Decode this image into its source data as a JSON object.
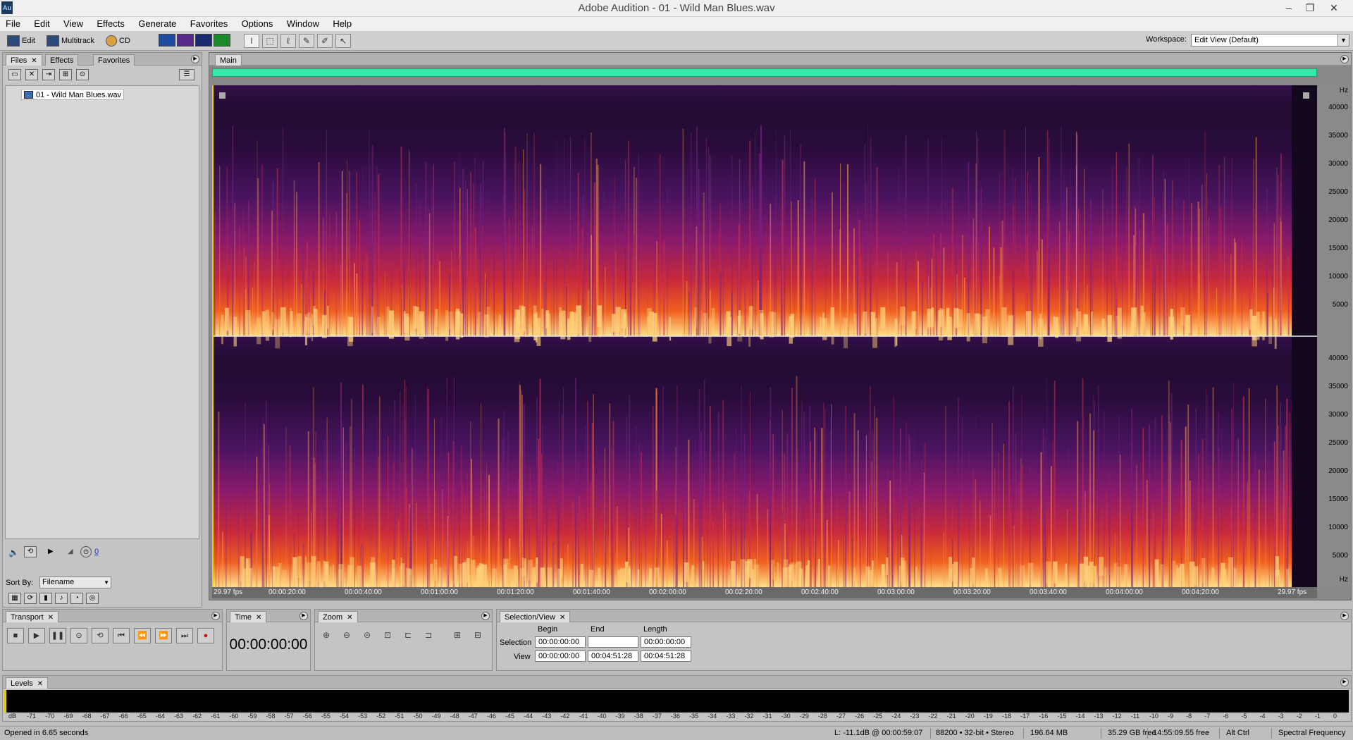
{
  "window": {
    "title": "Adobe Audition - 01 - Wild Man Blues.wav",
    "app_icon": "Au",
    "minimize": "–",
    "restore": "❐",
    "close": "✕"
  },
  "menu": [
    "File",
    "Edit",
    "View",
    "Effects",
    "Generate",
    "Favorites",
    "Options",
    "Window",
    "Help"
  ],
  "toolbar": {
    "edit_label": "Edit",
    "multitrack_label": "Multitrack",
    "cd_label": "CD",
    "workspace_label": "Workspace:",
    "workspace_value": "Edit View (Default)"
  },
  "files_panel": {
    "tabs": [
      "Files",
      "Effects",
      "Favorites"
    ],
    "file_name": "01 - Wild Man Blues.wav",
    "sort_label": "Sort By:",
    "sort_value": "Filename",
    "preview_counter": "0"
  },
  "main_panel": {
    "tab": "Main",
    "fps_left": "29.97 fps",
    "fps_right": "29.97 fps",
    "time_ticks": [
      "00:00:20:00",
      "00:00:40:00",
      "00:01:00:00",
      "00:01:20:00",
      "00:01:40:00",
      "00:02:00:00",
      "00:02:20:00",
      "00:02:40:00",
      "00:03:00:00",
      "00:03:20:00",
      "00:03:40:00",
      "00:04:00:00",
      "00:04:20:00"
    ],
    "hz_unit": "Hz",
    "hz_ticks": [
      "40000",
      "35000",
      "30000",
      "25000",
      "20000",
      "15000",
      "10000",
      "5000"
    ]
  },
  "transport": {
    "tab": "Transport"
  },
  "time_panel": {
    "tab": "Time",
    "display": "00:00:00:00"
  },
  "zoom_panel": {
    "tab": "Zoom"
  },
  "selection_view": {
    "tab": "Selection/View",
    "col_begin": "Begin",
    "col_end": "End",
    "col_length": "Length",
    "row_selection": "Selection",
    "row_view": "View",
    "sel_begin": "00:00:00:00",
    "sel_end": "",
    "sel_length": "00:00:00:00",
    "view_begin": "00:00:00:00",
    "view_end": "00:04:51:28",
    "view_length": "00:04:51:28"
  },
  "levels": {
    "tab": "Levels",
    "scale": [
      "dB",
      "-71",
      "-70",
      "-69",
      "-68",
      "-67",
      "-66",
      "-65",
      "-64",
      "-63",
      "-62",
      "-61",
      "-60",
      "-59",
      "-58",
      "-57",
      "-56",
      "-55",
      "-54",
      "-53",
      "-52",
      "-51",
      "-50",
      "-49",
      "-48",
      "-47",
      "-46",
      "-45",
      "-44",
      "-43",
      "-42",
      "-41",
      "-40",
      "-39",
      "-38",
      "-37",
      "-36",
      "-35",
      "-34",
      "-33",
      "-32",
      "-31",
      "-30",
      "-29",
      "-28",
      "-27",
      "-26",
      "-25",
      "-24",
      "-23",
      "-22",
      "-21",
      "-20",
      "-19",
      "-18",
      "-17",
      "-16",
      "-15",
      "-14",
      "-13",
      "-12",
      "-11",
      "-10",
      "-9",
      "-8",
      "-7",
      "-6",
      "-5",
      "-4",
      "-3",
      "-2",
      "-1",
      "0"
    ]
  },
  "status": {
    "opened": "Opened in 6.65 seconds",
    "cursor": "L: -11.1dB @ 00:00:59:07",
    "format": "88200 • 32-bit • Stereo",
    "size": "196.64 MB",
    "disk_free": "35.29 GB free",
    "time_free": "14:55:09.55 free",
    "keys": "Alt Ctrl",
    "view_mode": "Spectral Frequency"
  },
  "colors": {
    "overview": "#38e8a8",
    "spectro_bg": "#1a0b2a",
    "spectro_hot": "#ffd27a",
    "spectro_mid": "#d43a3a",
    "spectro_low": "#5a1a7a"
  }
}
